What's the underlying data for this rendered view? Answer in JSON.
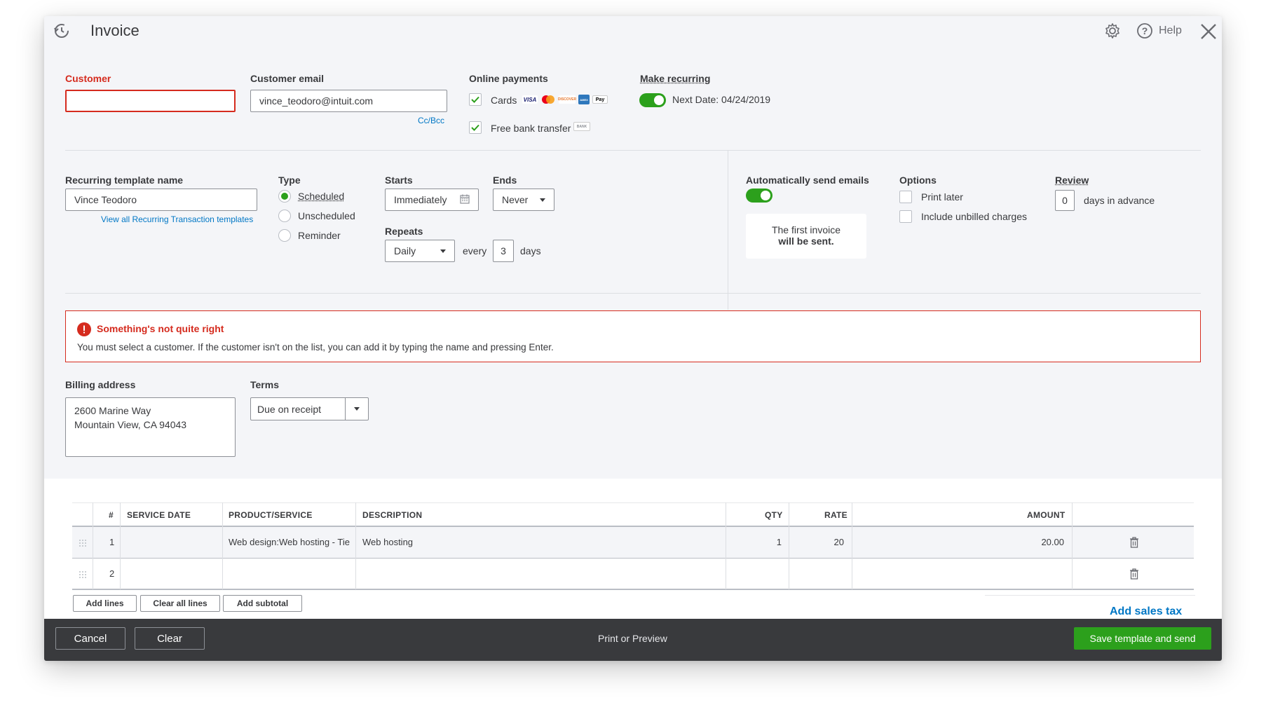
{
  "header": {
    "title": "Invoice",
    "help_label": "Help"
  },
  "customer": {
    "label": "Customer",
    "value": ""
  },
  "customer_email": {
    "label": "Customer email",
    "value": "vince_teodoro@intuit.com",
    "ccbcc_link": "Cc/Bcc"
  },
  "online_payments": {
    "label": "Online payments",
    "cards_label": "Cards",
    "card_logos": [
      "VISA",
      "MC",
      "DISCOVER",
      "AMEX",
      "Pay"
    ],
    "bank_label": "Free bank transfer",
    "bank_badge": "BANK"
  },
  "make_recurring": {
    "label": "Make recurring",
    "next_date": "Next Date: 04/24/2019"
  },
  "recurring": {
    "template_name_label": "Recurring template name",
    "template_name_value": "Vince Teodoro",
    "view_all_link": "View all Recurring Transaction templates",
    "type_label": "Type",
    "types": [
      "Scheduled",
      "Unscheduled",
      "Reminder"
    ],
    "starts_label": "Starts",
    "starts_value": "Immediately",
    "ends_label": "Ends",
    "ends_value": "Never",
    "repeats_label": "Repeats",
    "repeats_value": "Daily",
    "every_label": "every",
    "every_value": "3",
    "days_label": "days"
  },
  "auto_send": {
    "label": "Automatically send emails",
    "info_line1": "The first invoice",
    "info_line2": "will be sent."
  },
  "options": {
    "label": "Options",
    "print_later": "Print later",
    "include_unbilled": "Include unbilled charges"
  },
  "review": {
    "label": "Review",
    "value": "0",
    "suffix": "days in advance"
  },
  "error": {
    "title": "Something's not quite right",
    "message": "You must select a customer. If the customer isn't on the list, you can add it by typing the name and pressing Enter."
  },
  "billing": {
    "label": "Billing address",
    "line1": "2600 Marine Way",
    "line2": "Mountain View, CA 94043"
  },
  "terms": {
    "label": "Terms",
    "value": "Due on receipt"
  },
  "table": {
    "headers": {
      "num": "#",
      "service_date": "SERVICE DATE",
      "product": "PRODUCT/SERVICE",
      "description": "DESCRIPTION",
      "qty": "QTY",
      "rate": "RATE",
      "amount": "AMOUNT"
    },
    "rows": [
      {
        "num": "1",
        "service_date": "",
        "product": "Web design:Web hosting - Tie",
        "description": "Web hosting",
        "qty": "1",
        "rate": "20",
        "amount": "20.00"
      },
      {
        "num": "2",
        "service_date": "",
        "product": "",
        "description": "",
        "qty": "",
        "rate": "",
        "amount": ""
      }
    ]
  },
  "table_actions": {
    "add_lines": "Add lines",
    "clear_all": "Clear all lines",
    "add_subtotal": "Add subtotal",
    "add_sales_tax": "Add sales tax"
  },
  "footer": {
    "cancel": "Cancel",
    "clear": "Clear",
    "print_preview": "Print or Preview",
    "save_send": "Save template and send"
  },
  "colors": {
    "accent_green": "#2ca01c",
    "error_red": "#d52b1e",
    "link_blue": "#0077c5",
    "footer_bg": "#393a3d"
  }
}
